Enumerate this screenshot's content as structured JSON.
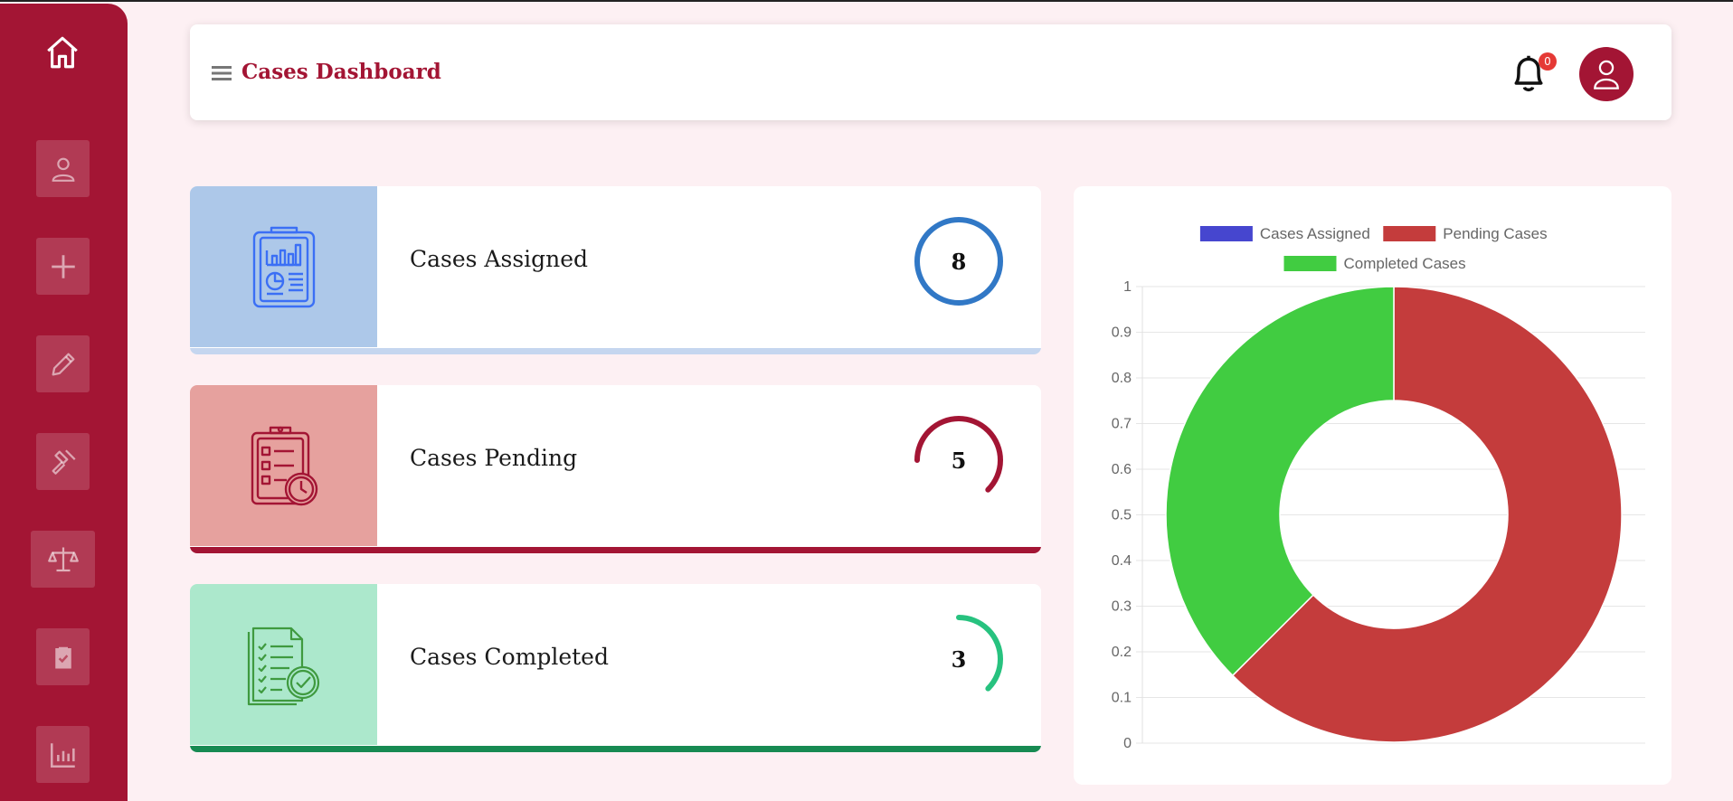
{
  "sidebar": {
    "items": [
      {
        "icon": "home-icon"
      },
      {
        "icon": "user-icon"
      },
      {
        "icon": "plus-icon"
      },
      {
        "icon": "pencil-icon"
      },
      {
        "icon": "gavel-icon"
      },
      {
        "icon": "scales-icon"
      },
      {
        "icon": "clipboard-check-icon"
      },
      {
        "icon": "bar-chart-icon"
      }
    ]
  },
  "header": {
    "title": "Cases Dashboard",
    "notification_count": "0"
  },
  "cards": [
    {
      "label": "Cases Assigned",
      "value": "8",
      "color": "#3178c6",
      "panel_color": "#adc8e9",
      "bar_color": "#c5d6ef",
      "ring_fraction": 1.0
    },
    {
      "label": "Cases Pending",
      "value": "5",
      "color": "#a31534",
      "panel_color": "#e6a19e",
      "bar_color": "#a31534",
      "ring_fraction": 0.625
    },
    {
      "label": "Cases Completed",
      "value": "3",
      "color": "#27c27f",
      "panel_color": "#ace8cc",
      "bar_color": "#178a52",
      "ring_fraction": 0.375
    }
  ],
  "chart_data": {
    "type": "pie",
    "legend": [
      {
        "label": "Cases Assigned",
        "color": "#4646cf"
      },
      {
        "label": "Pending Cases",
        "color": "#c43c3c"
      },
      {
        "label": "Completed Cases",
        "color": "#41cc41"
      }
    ],
    "legend_position": "top",
    "slices": [
      {
        "label": "Cases Assigned",
        "value": 0,
        "color": "#4646cf"
      },
      {
        "label": "Pending Cases",
        "value": 5,
        "color": "#c43c3c"
      },
      {
        "label": "Completed Cases",
        "value": 3,
        "color": "#41cc41"
      }
    ],
    "y_ticks": [
      "0",
      "0.1",
      "0.2",
      "0.3",
      "0.4",
      "0.5",
      "0.6",
      "0.7",
      "0.8",
      "0.9",
      "1"
    ],
    "ylim": [
      0,
      1
    ],
    "grid": true
  }
}
